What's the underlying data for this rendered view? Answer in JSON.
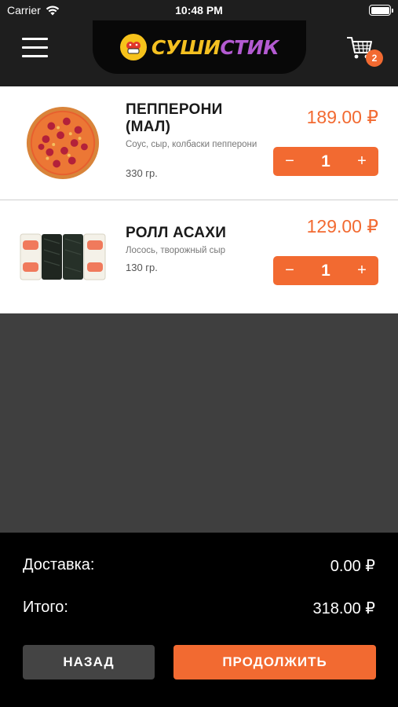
{
  "status_bar": {
    "carrier": "Carrier",
    "time": "10:48 PM"
  },
  "header": {
    "logo_text_1": "СУШИ",
    "logo_text_2": "СТИК",
    "cart_count": "2"
  },
  "cart_items": [
    {
      "name_line1": "ПЕППЕРОНИ",
      "name_line2": "(МАЛ)",
      "description": "Соус, сыр, колбаски пепперони",
      "weight": "330 гр.",
      "price": "189.00 ₽",
      "quantity": "1",
      "image": "pizza-pepperoni"
    },
    {
      "name_line1": "РОЛЛ АСАХИ",
      "name_line2": "",
      "description": "Лосось, творожный сыр",
      "weight": "130 гр.",
      "price": "129.00 ₽",
      "quantity": "1",
      "image": "sushi-roll"
    }
  ],
  "stepper": {
    "minus": "−",
    "plus": "+"
  },
  "summary": {
    "delivery_label": "Доставка:",
    "delivery_value": "0.00 ₽",
    "total_label": "Итого:",
    "total_value": "318.00 ₽"
  },
  "buttons": {
    "back": "НАЗАД",
    "continue": "ПРОДОЛЖИТЬ"
  },
  "colors": {
    "accent": "#f26a31",
    "header_bg": "#1e1e1e",
    "footer_bg": "#000000",
    "empty_bg": "#3f3f3f"
  }
}
